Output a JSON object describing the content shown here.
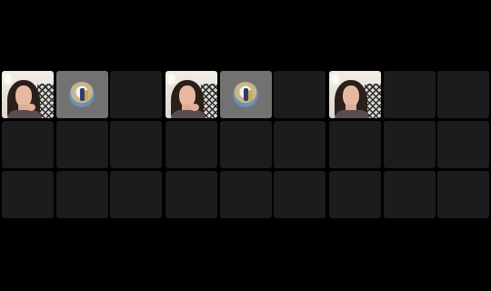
{
  "app": {
    "background_color": "#000000",
    "tile_color": "#1c1c1e",
    "avatar_tile_color": "#727272"
  },
  "grids": [
    {
      "tiles": [
        {
          "type": "video",
          "icon": "participant-video"
        },
        {
          "type": "avatar",
          "icon": "profile-avatar"
        },
        {
          "type": "empty"
        },
        {
          "type": "empty"
        },
        {
          "type": "empty"
        },
        {
          "type": "empty"
        },
        {
          "type": "empty"
        },
        {
          "type": "empty"
        },
        {
          "type": "empty"
        }
      ]
    },
    {
      "tiles": [
        {
          "type": "video",
          "icon": "participant-video"
        },
        {
          "type": "avatar",
          "icon": "profile-avatar"
        },
        {
          "type": "empty"
        },
        {
          "type": "empty"
        },
        {
          "type": "empty"
        },
        {
          "type": "empty"
        },
        {
          "type": "empty"
        },
        {
          "type": "empty"
        },
        {
          "type": "empty"
        }
      ]
    },
    {
      "tiles": [
        {
          "type": "video",
          "icon": "participant-video"
        },
        {
          "type": "empty"
        },
        {
          "type": "empty"
        },
        {
          "type": "empty"
        },
        {
          "type": "empty"
        },
        {
          "type": "empty"
        },
        {
          "type": "empty"
        },
        {
          "type": "empty"
        },
        {
          "type": "empty"
        }
      ]
    }
  ]
}
